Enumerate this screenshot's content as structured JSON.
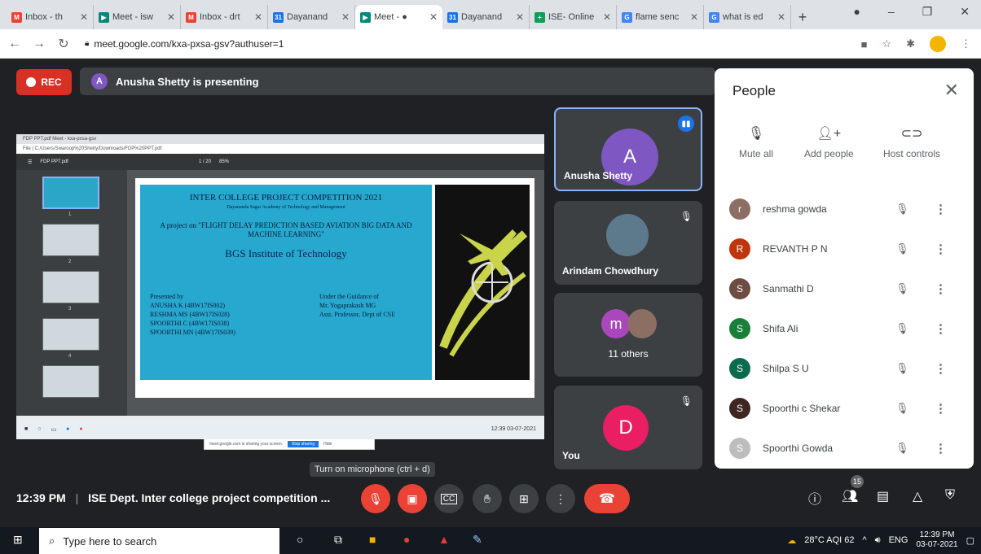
{
  "browser": {
    "tabs": [
      {
        "label": "Inbox - th",
        "color": "#ea4335",
        "icon": "M"
      },
      {
        "label": "Meet - isw",
        "color": "#00897b",
        "icon": "▶"
      },
      {
        "label": "Inbox - drt",
        "color": "#ea4335",
        "icon": "M"
      },
      {
        "label": "Dayanand",
        "color": "#1a73e8",
        "icon": "31"
      },
      {
        "label": "Meet - ●",
        "color": "#00897b",
        "icon": "▶"
      },
      {
        "label": "Dayanand",
        "color": "#1a73e8",
        "icon": "31"
      },
      {
        "label": "ISE- Online",
        "color": "#0f9d58",
        "icon": "+"
      },
      {
        "label": "flame senc",
        "color": "#4285f4",
        "icon": "G"
      },
      {
        "label": "what is ed",
        "color": "#4285f4",
        "icon": "G"
      }
    ],
    "url": "meet.google.com/kxa-pxsa-gsv?authuser=1"
  },
  "meet": {
    "rec_label": "REC",
    "presenter_initial": "A",
    "presenting_text": "Anusha Shetty is presenting",
    "screen": {
      "tabs": "FDP PPT.pdf      Meet - kxa-pxsa-gsv",
      "address": "File | C:/Users/Swaroop%20Shetty/Downloads/FDP%20PPT.pdf",
      "doc_name": "FDP PPT.pdf",
      "page": "1 / 20",
      "zoom": "85%",
      "slide": {
        "title": "INTER COLLEGE PROJECT COMPETITION  2021",
        "subtitle": "Dayananda Sagar Academy of Technology and Management",
        "project": "A project on \"FLIGHT DELAY PREDICTION BASED AVIATION BIG DATA  AND  MACHINE LEARNING\"",
        "institute": "BGS Institute of  Technology",
        "presented_by": [
          "Presented by",
          "ANUSHA K (4BW17IS002)",
          "RESHMA MS (4BW17IS028)",
          "SPOORTHI C (4BW17IS038)",
          "SPOORTHI MN (4BW17IS039)"
        ],
        "guidance": [
          "Under the Guidance of",
          "Mr. Yogaprakash MG",
          "Asst. Professor, Dept of CSE"
        ]
      },
      "share_text": "meet.google.com is sharing your screen.",
      "stop_label": "Stop sharing",
      "hide_label": "Hide",
      "taskbar_time": "12:39 03-07-2021"
    },
    "tiles": [
      {
        "name": "Anusha Shetty",
        "initial": "A",
        "color": "#7e57c2"
      },
      {
        "name": "Arindam Chowdhury"
      },
      {
        "name": "11 others",
        "initial": "m",
        "color": "#ab47bc"
      },
      {
        "name": "You",
        "initial": "D",
        "color": "#e91e63"
      }
    ],
    "tooltip": "Turn on microphone (ctrl + d)",
    "time": "12:39 PM",
    "separator": "|",
    "meeting_title": "ISE Dept. Inter college project competition ...",
    "participant_count": "15"
  },
  "people": {
    "title": "People",
    "actions": [
      "Mute all",
      "Add people",
      "Host controls"
    ],
    "list": [
      {
        "name": "reshma gowda",
        "initial": "r",
        "color": "#8d6e63"
      },
      {
        "name": "REVANTH P N",
        "initial": "R",
        "color": "#bf360c"
      },
      {
        "name": "Sanmathi D",
        "initial": "S",
        "color": "#6d4c41"
      },
      {
        "name": "Shifa Ali",
        "initial": "S",
        "color": "#188038"
      },
      {
        "name": "Shilpa S U",
        "initial": "S",
        "color": "#0b6b4f"
      },
      {
        "name": "Spoorthi c Shekar",
        "initial": "S",
        "color": "#3e2723"
      },
      {
        "name": "Spoorthi Gowda",
        "initial": "S",
        "color": "#bdbdbd"
      }
    ]
  },
  "taskbar": {
    "search_placeholder": "Type here to search",
    "weather": "28°C  AQI 62",
    "lang": "ENG",
    "time": "12:39 PM",
    "date": "03-07-2021"
  }
}
